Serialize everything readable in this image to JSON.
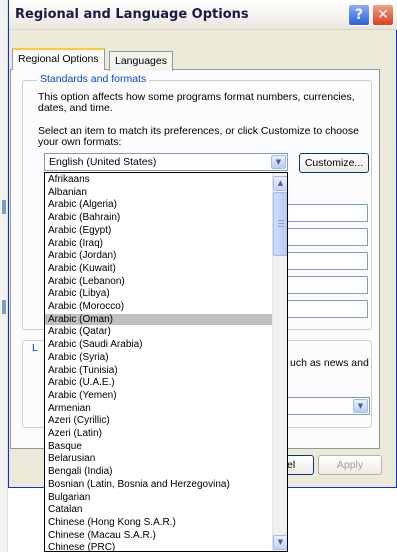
{
  "window": {
    "title": "Regional and Language Options",
    "help_glyph": "?",
    "close_glyph": "✕"
  },
  "tabs": [
    {
      "label": "Regional Options",
      "active": true
    },
    {
      "label": "Languages",
      "active": false
    }
  ],
  "standards": {
    "legend": "Standards and formats",
    "description": "This option affects how some programs format numbers, currencies, dates, and time.",
    "instruction": "Select an item to match its preferences, or click Customize to choose your own formats:",
    "selected_value": "English (United States)",
    "customize_label": "Customize..."
  },
  "location": {
    "partial_text": "uch as news and",
    "partial_legend": "L"
  },
  "buttons": {
    "cancel_partial": "el",
    "apply": "Apply"
  },
  "dropdown": {
    "highlighted": "Arabic (Oman)",
    "items": [
      "Afrikaans",
      "Albanian",
      "Arabic (Algeria)",
      "Arabic (Bahrain)",
      "Arabic (Egypt)",
      "Arabic (Iraq)",
      "Arabic (Jordan)",
      "Arabic (Kuwait)",
      "Arabic (Lebanon)",
      "Arabic (Libya)",
      "Arabic (Morocco)",
      "Arabic (Oman)",
      "Arabic (Qatar)",
      "Arabic (Saudi Arabia)",
      "Arabic (Syria)",
      "Arabic (Tunisia)",
      "Arabic (U.A.E.)",
      "Arabic (Yemen)",
      "Armenian",
      "Azeri (Cyrillic)",
      "Azeri (Latin)",
      "Basque",
      "Belarusian",
      "Bengali (India)",
      "Bosnian (Latin, Bosnia and Herzegovina)",
      "Bulgarian",
      "Catalan",
      "Chinese (Hong Kong S.A.R.)",
      "Chinese (Macau S.A.R.)",
      "Chinese (PRC)"
    ]
  },
  "colors": {
    "dialog_bg": "#ece9d8",
    "group_legend": "#0046d5",
    "selection": "#c0c0c0",
    "frame_blue": "#0831d9"
  }
}
